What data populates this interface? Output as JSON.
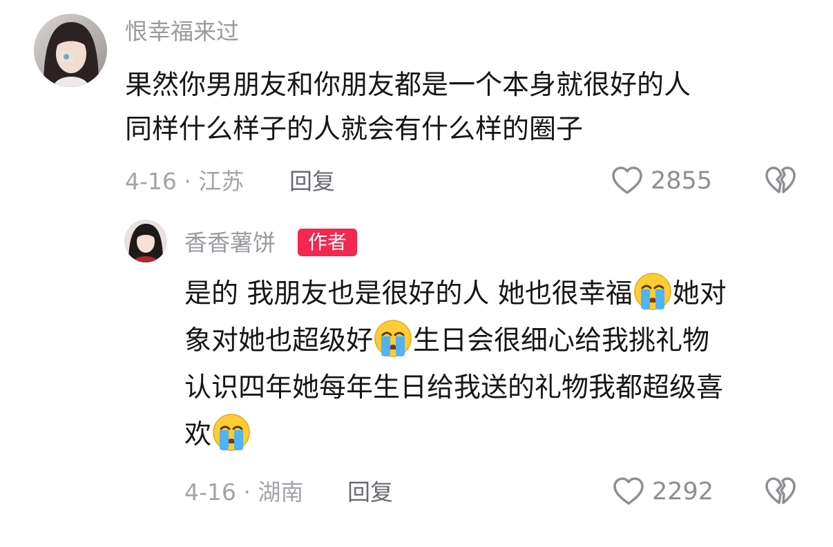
{
  "comment": {
    "username": "恨幸福来过",
    "lines": [
      "果然你男朋友和你朋友都是一个本身就很好的人",
      "同样什么样子的人就会有什么样的圈子"
    ],
    "date_location": "4-16 · 江苏",
    "reply_label": "回复",
    "like_count": "2855"
  },
  "reply": {
    "username": "香香薯饼",
    "badge": "作者",
    "line1_a": "是的 我朋友也是很好的人 她也很幸福",
    "line1_b": "她对",
    "line2_a": "象对她也超级好",
    "line2_b": "生日会很细心给我挑礼物",
    "line3": "认识四年她每年生日给我送的礼物我都超级喜",
    "line4": "欢",
    "emoji_name": "loudly-crying-face-emoji",
    "date_location": "4-16 · 湖南",
    "reply_label": "回复",
    "like_count": "2292"
  },
  "colors": {
    "username": "#9a9aa0",
    "meta": "#a3a3a8",
    "badge": "#f3274f",
    "icon": "#8e8e93"
  },
  "icons": {
    "like": "heart-outline-icon",
    "dislike": "broken-heart-icon"
  }
}
